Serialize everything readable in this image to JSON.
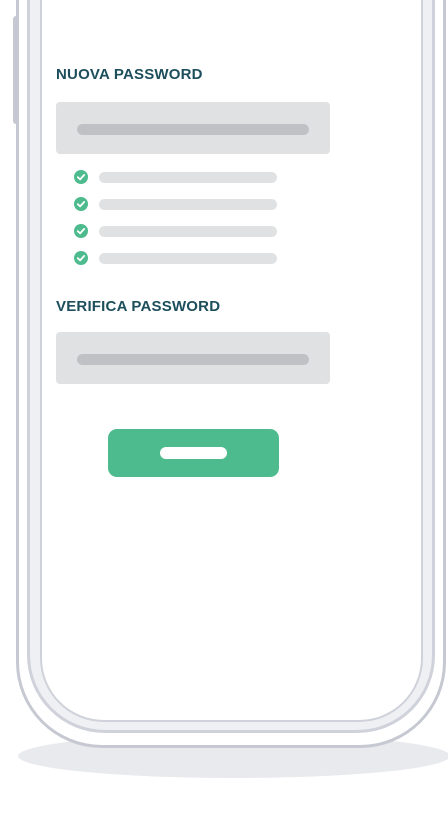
{
  "new_password": {
    "label": "NUOVA PASSWORD",
    "requirements_met": [
      true,
      true,
      true,
      true
    ]
  },
  "verify_password": {
    "label": "VERIFICA PASSWORD"
  },
  "colors": {
    "label": "#1d4e5c",
    "accent": "#4dbb8d",
    "field": "#e0e1e3",
    "placeholder_bar": "#c0c1c4",
    "device_frame": "#c6c9d2"
  },
  "icons": {
    "requirement": "check-circle-icon"
  }
}
